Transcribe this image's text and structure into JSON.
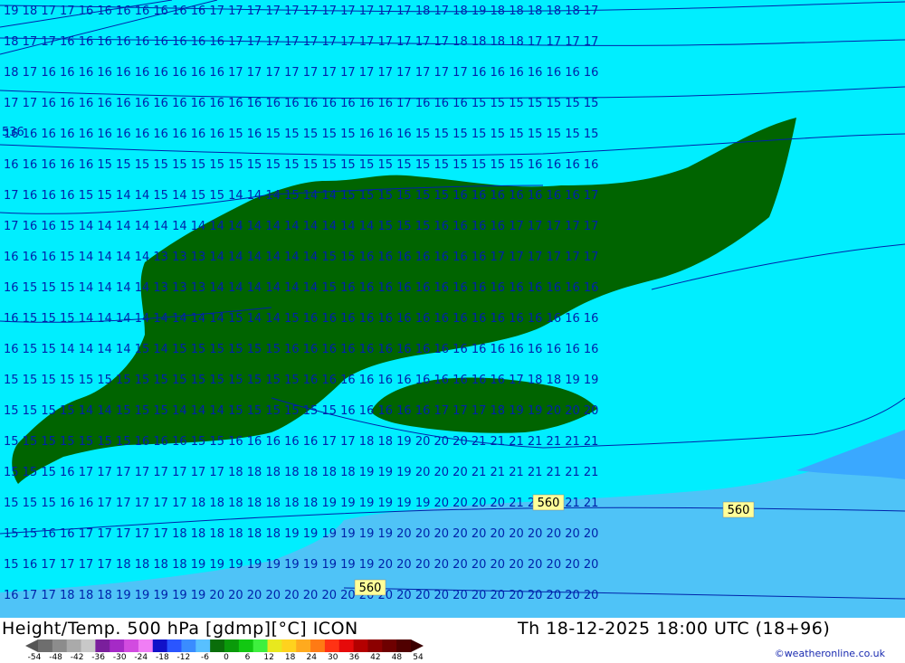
{
  "footer": {
    "title": "Height/Temp. 500 hPa [gdmp][°C] ICON",
    "time": "Th 18-12-2025 18:00 UTC (18+96)",
    "credit": "©weatheronline.co.uk"
  },
  "legend": {
    "ticks": [
      "-54",
      "-48",
      "-42",
      "-36",
      "-30",
      "-24",
      "-18",
      "-12",
      "-6",
      "0",
      "6",
      "12",
      "18",
      "24",
      "30",
      "36",
      "42",
      "48",
      "54"
    ],
    "colors": [
      "#6e6e6e",
      "#8c8c8c",
      "#aaaaaa",
      "#c8c8c8",
      "#7a1f9c",
      "#a52ac6",
      "#d24be0",
      "#f07ef5",
      "#1111c8",
      "#2a55ff",
      "#3a8cff",
      "#58c0ff",
      "#0a6e0a",
      "#0a9a0a",
      "#12c812",
      "#3ef03e",
      "#e8e81e",
      "#ffd21e",
      "#ffaa1e",
      "#ff7a14",
      "#ff3214",
      "#e60a0a",
      "#b40000",
      "#8c0000",
      "#6e0000",
      "#500000"
    ]
  },
  "map": {
    "colors": {
      "cyan": "#00eeff",
      "light_blue": "#4fc3f7",
      "mid_blue": "#3aa8ff",
      "dark_green": "#006400",
      "contour": "#0022aa",
      "label_box": "#ffff99"
    },
    "height_labels": [
      "560",
      "560",
      "560"
    ],
    "corner_label": "536"
  }
}
